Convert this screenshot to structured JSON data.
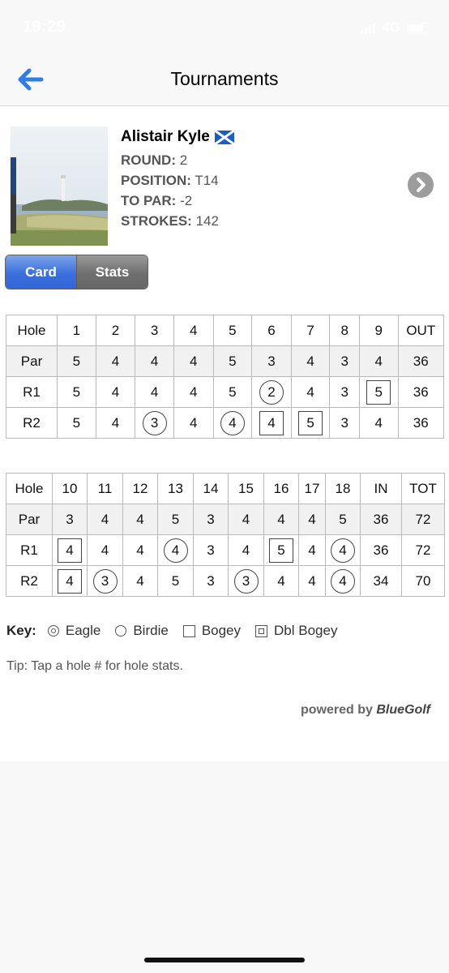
{
  "status": {
    "time": "19:29",
    "network": "4G"
  },
  "nav": {
    "title": "Tournaments"
  },
  "player": {
    "name": "Alistair Kyle",
    "round_label": "ROUND:",
    "round": "2",
    "position_label": "POSITION:",
    "position": "T14",
    "topar_label": "TO PAR:",
    "topar": "-2",
    "strokes_label": "STROKES:",
    "strokes": "142"
  },
  "tabs": {
    "card": "Card",
    "stats": "Stats"
  },
  "front": {
    "header": [
      "Hole",
      "1",
      "2",
      "3",
      "4",
      "5",
      "6",
      "7",
      "8",
      "9",
      "OUT"
    ],
    "rows": [
      {
        "label": "Par",
        "cells": [
          {
            "v": "5"
          },
          {
            "v": "4"
          },
          {
            "v": "4"
          },
          {
            "v": "4"
          },
          {
            "v": "5"
          },
          {
            "v": "3"
          },
          {
            "v": "4"
          },
          {
            "v": "3"
          },
          {
            "v": "4"
          },
          {
            "v": "36"
          }
        ]
      },
      {
        "label": "R1",
        "cells": [
          {
            "v": "5"
          },
          {
            "v": "4"
          },
          {
            "v": "4"
          },
          {
            "v": "4"
          },
          {
            "v": "5"
          },
          {
            "v": "2",
            "m": "birdie"
          },
          {
            "v": "4"
          },
          {
            "v": "3"
          },
          {
            "v": "5",
            "m": "bogey"
          },
          {
            "v": "36"
          }
        ]
      },
      {
        "label": "R2",
        "cells": [
          {
            "v": "5"
          },
          {
            "v": "4"
          },
          {
            "v": "3",
            "m": "birdie"
          },
          {
            "v": "4"
          },
          {
            "v": "4",
            "m": "birdie"
          },
          {
            "v": "4",
            "m": "bogey"
          },
          {
            "v": "5",
            "m": "bogey"
          },
          {
            "v": "3"
          },
          {
            "v": "4"
          },
          {
            "v": "36"
          }
        ]
      }
    ]
  },
  "back": {
    "header": [
      "Hole",
      "10",
      "11",
      "12",
      "13",
      "14",
      "15",
      "16",
      "17",
      "18",
      "IN",
      "TOT"
    ],
    "rows": [
      {
        "label": "Par",
        "cells": [
          {
            "v": "3"
          },
          {
            "v": "4"
          },
          {
            "v": "4"
          },
          {
            "v": "5"
          },
          {
            "v": "3"
          },
          {
            "v": "4"
          },
          {
            "v": "4"
          },
          {
            "v": "4"
          },
          {
            "v": "5"
          },
          {
            "v": "36"
          },
          {
            "v": "72"
          }
        ]
      },
      {
        "label": "R1",
        "cells": [
          {
            "v": "4",
            "m": "bogey"
          },
          {
            "v": "4"
          },
          {
            "v": "4"
          },
          {
            "v": "4",
            "m": "birdie"
          },
          {
            "v": "3"
          },
          {
            "v": "4"
          },
          {
            "v": "5",
            "m": "bogey"
          },
          {
            "v": "4"
          },
          {
            "v": "4",
            "m": "birdie"
          },
          {
            "v": "36"
          },
          {
            "v": "72"
          }
        ]
      },
      {
        "label": "R2",
        "cells": [
          {
            "v": "4",
            "m": "bogey"
          },
          {
            "v": "3",
            "m": "birdie"
          },
          {
            "v": "4"
          },
          {
            "v": "5"
          },
          {
            "v": "3"
          },
          {
            "v": "3",
            "m": "birdie"
          },
          {
            "v": "4"
          },
          {
            "v": "4"
          },
          {
            "v": "4",
            "m": "birdie"
          },
          {
            "v": "34"
          },
          {
            "v": "70"
          }
        ]
      }
    ]
  },
  "key": {
    "label": "Key:",
    "eagle": "Eagle",
    "birdie": "Birdie",
    "bogey": "Bogey",
    "dbl_bogey": "Dbl Bogey"
  },
  "tip": "Tip: Tap a hole # for hole stats.",
  "powered": {
    "prefix": "powered by",
    "brand": "BlueGolf"
  },
  "colors": {
    "accent": "#3b6fdc",
    "tab_inactive": "#6f6f6f",
    "back_arrow": "#2f7de6"
  }
}
